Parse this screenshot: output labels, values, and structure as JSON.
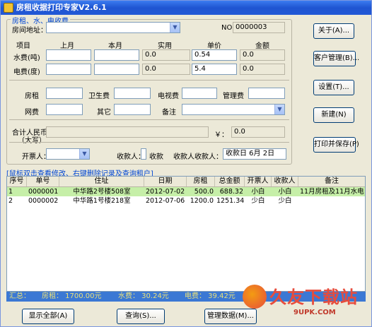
{
  "window": {
    "title": "房租收据打印专家V2.6.1"
  },
  "group_main": {
    "title": "房租、水、电收费"
  },
  "address": {
    "label": "房间地址：",
    "value": ""
  },
  "number": {
    "label": "NO",
    "value": "0000003"
  },
  "utility_headers": {
    "item": "项目",
    "last_month": "上月",
    "this_month": "本月",
    "actual": "实用",
    "unit_price": "单价",
    "amount": "金额"
  },
  "water": {
    "label": "水费(吨)",
    "last": "",
    "current": "",
    "actual": "0.0",
    "price": "0.54",
    "amount": "0.0"
  },
  "power": {
    "label": "电费(度)",
    "last": "",
    "current": "",
    "actual": "0.0",
    "price": "5.4",
    "amount": "0.0"
  },
  "fees": {
    "rent": "房租",
    "sanitation": "卫生费",
    "tv": "电视费",
    "management": "管理费",
    "internet": "网费",
    "other": "其它",
    "note": "备注"
  },
  "total": {
    "label_line1": "合计人民币",
    "label_line2": "（大写）",
    "currency": "￥：",
    "value": "0.0"
  },
  "issuer": {
    "label": "开票人：",
    "value": ""
  },
  "receiver": {
    "label": "收款人：",
    "value": "收款",
    "label2": "收款人",
    "label3": "收款人：",
    "date": "收款日   6月  2日"
  },
  "buttons": {
    "about": "关于(A)...",
    "customer_mgmt": "客户管理(B)...",
    "settings": "设置(T)...",
    "new": "新建(N)",
    "print_save": "打印并保存(P)",
    "show_all": "显示全部(A)",
    "query": "查询(S)...",
    "manage_data": "管理数据(M)..."
  },
  "hint": "[鼠标双击查看修改、右键删除记录及查询租户]",
  "table": {
    "headers": [
      "序号",
      "单号",
      "住址",
      "日期",
      "房租",
      "总金额",
      "开票人",
      "收款人",
      "备注"
    ],
    "rows": [
      {
        "seq": "1",
        "no": "0000001",
        "addr": "中华路2号楼508室",
        "date": "2012-07-02",
        "rent": "500.0",
        "total": "688.32",
        "issuer": "小白",
        "receiver": "小白",
        "note": "11月房租及11月水电"
      },
      {
        "seq": "2",
        "no": "0000002",
        "addr": "中华路1号楼218室",
        "date": "2012-07-06",
        "rent": "1200.0",
        "total": "1251.34",
        "issuer": "少白",
        "receiver": "少白",
        "note": ""
      }
    ]
  },
  "summary": {
    "label": "汇总：",
    "rent": "房租： 1700.00元",
    "water": "水费： 30.24元",
    "power": "电费： 39.42元"
  },
  "watermark": {
    "text": "久友下载站",
    "url": "9UPK.COM"
  }
}
